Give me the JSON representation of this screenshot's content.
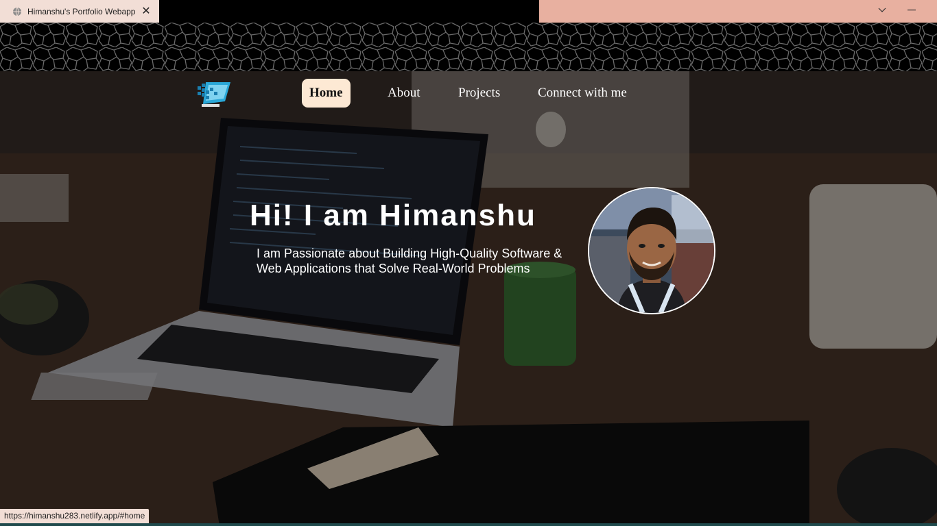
{
  "browser": {
    "tab_title": "Himanshu's Portfolio Webapp",
    "tab_icon": "globe-icon",
    "close_icon": "close-icon",
    "status_url": "https://himanshu283.netlify.app/#home",
    "colors": {
      "tab_bg": "#f2ded6",
      "chrome_accent": "#e8b0a0"
    }
  },
  "nav": {
    "items": [
      {
        "label": "Home",
        "active": true
      },
      {
        "label": "About",
        "active": false
      },
      {
        "label": "Projects",
        "active": false
      },
      {
        "label": "Connect with me",
        "active": false
      }
    ],
    "active_bg": "#fde9d4"
  },
  "hero": {
    "title": "Hi! I am Himanshu",
    "subtitle": "I am Passionate about Building High-Quality Software & Web Applications that Solve Real-World Problems"
  }
}
